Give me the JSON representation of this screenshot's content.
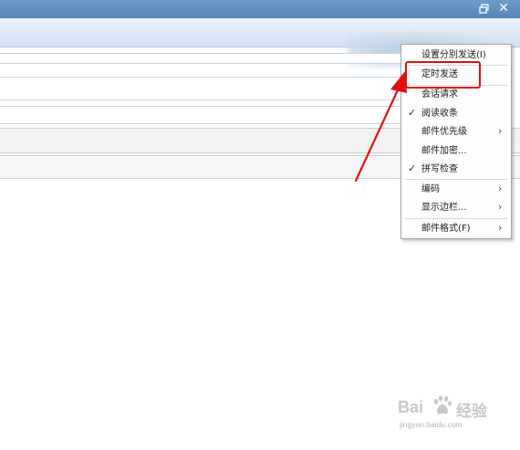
{
  "window": {
    "close_glyph": "✕"
  },
  "menu": {
    "items": [
      {
        "label": "设置分别发送(I)",
        "checked": false,
        "submenu": false
      },
      {
        "label": "定时发送",
        "checked": false,
        "submenu": false,
        "highlighted": true
      },
      {
        "label": "会话请求",
        "checked": false,
        "submenu": false
      },
      {
        "label": "阅读收条",
        "checked": true,
        "submenu": false
      },
      {
        "label": "邮件优先级",
        "checked": false,
        "submenu": true
      },
      {
        "label": "邮件加密...",
        "checked": false,
        "submenu": false
      },
      {
        "label": "拼写检查",
        "checked": true,
        "submenu": false
      },
      {
        "label": "编码",
        "checked": false,
        "submenu": true
      },
      {
        "label": "显示边栏...",
        "checked": false,
        "submenu": true
      },
      {
        "label": "邮件格式(F)",
        "checked": false,
        "submenu": true
      }
    ],
    "check_glyph": "✓",
    "arrow_glyph": "›"
  },
  "annotation": {
    "color": "#e01010"
  },
  "watermark": {
    "brand": "Bai",
    "brand_cn": "经验",
    "url": "jingyan.baidu.com"
  },
  "icons": {
    "restore": "restore-window-icon",
    "close": "close-icon",
    "paw": "baidu-paw-icon"
  }
}
